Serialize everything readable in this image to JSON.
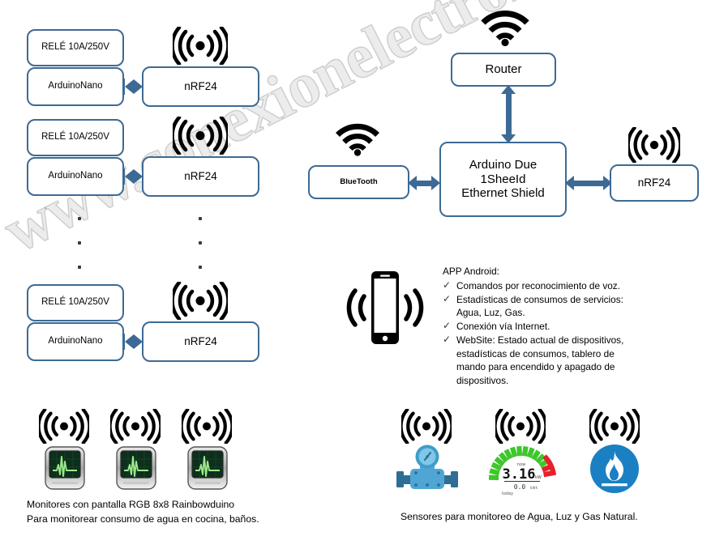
{
  "watermark": {
    "text": "www.conexionelectronica.com"
  },
  "nodes": {
    "relay_label": "RELÉ 10A/250V",
    "arduino_nano_label": "ArduinoNano",
    "nrf24_label": "nRF24",
    "router_label": "Router",
    "bluetooth_label": "BlueTooth",
    "hub_label": "Arduino Due\n1SheeId\nEthernet Shield",
    "hub_line1": "Arduino Due",
    "hub_line2": "1SheeId",
    "hub_line3": "Ethernet Shield"
  },
  "groups": [
    {
      "relay": "RELÉ 10A/250V",
      "mcu": "ArduinoNano",
      "radio": "nRF24"
    },
    {
      "relay": "RELÉ 10A/250V",
      "mcu": "ArduinoNano",
      "radio": "nRF24"
    },
    {
      "relay": "RELÉ 10A/250V",
      "mcu": "ArduinoNano",
      "radio": "nRF24"
    }
  ],
  "app": {
    "heading": "APP Android:",
    "items": [
      "Comandos por reconocimiento de voz.",
      "Estadísticas de consumos de servicios: Agua, Luz, Gas.",
      "Conexión vía Internet.",
      "WebSite: Estado actual de dispositivos, estadísticas de consumos, tablero de mando para encendido y apagado de dispositivos."
    ],
    "check_glyph": "✓"
  },
  "captions": {
    "monitors": "Monitores con pantalla RGB 8x8 Rainbowduino\nPara monitorear consumo de agua en cocina, baños.",
    "sensors": "Sensores para monitoreo de Agua, Luz y Gas Natural."
  },
  "meter": {
    "now_label": "now",
    "value": "3.16",
    "unit": "kW",
    "today_value": "0.0",
    "today_unit": "kWh",
    "today_label": "today"
  },
  "icons": {
    "rf_antenna": "rf-antenna-icon",
    "wifi": "wifi-icon",
    "phone": "smartphone-icon",
    "monitor": "rgb-monitor-icon",
    "water_valve": "water-valve-sensor-icon",
    "energy_meter": "energy-meter-icon",
    "gas_flame": "gas-flame-icon"
  },
  "colors": {
    "box_border": "#3d6a94",
    "arrow": "#3d6a94",
    "icon_black": "#000000",
    "sensor_blue": "#2f9fd8",
    "gas_blue": "#1b7fc4",
    "meter_green": "#3ec72b",
    "meter_red": "#e8202a",
    "monitor_screen": "#123a22",
    "monitor_trace": "#8ce07a"
  }
}
